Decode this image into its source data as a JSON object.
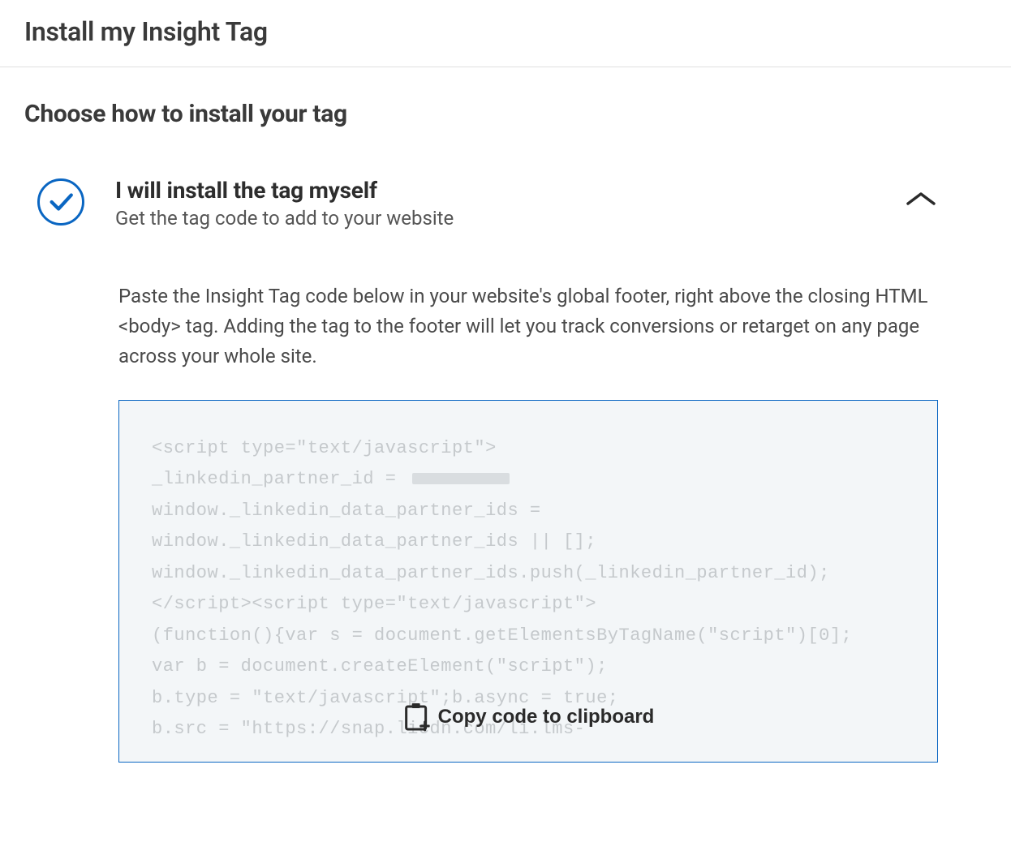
{
  "header": {
    "title": "Install my Insight Tag"
  },
  "section": {
    "title": "Choose how to install your tag"
  },
  "option": {
    "title": "I will install the tag myself",
    "subtitle": "Get the tag code to add to your website",
    "instructions": "Paste the Insight Tag code below in your website's global footer, right above the closing HTML <body> tag. Adding the tag to the footer will let you track conversions or retarget on any page across your whole site."
  },
  "code": {
    "line1": "<script type=\"text/javascript\">",
    "line2a": "_linkedin_partner_id = ",
    "line3": "window._linkedin_data_partner_ids = ",
    "line4": "window._linkedin_data_partner_ids || [];",
    "line5": "window._linkedin_data_partner_ids.push(_linkedin_partner_id);",
    "line6": "</script><script type=\"text/javascript\">",
    "line7": "(function(){var s = document.getElementsByTagName(\"script\")[0];",
    "line8": "var b = document.createElement(\"script\");",
    "line9": "b.type = \"text/javascript\";b.async = true;",
    "line10": "b.src = \"https://snap.licdn.com/li.lms-"
  },
  "copy": {
    "label": "Copy code to clipboard"
  }
}
